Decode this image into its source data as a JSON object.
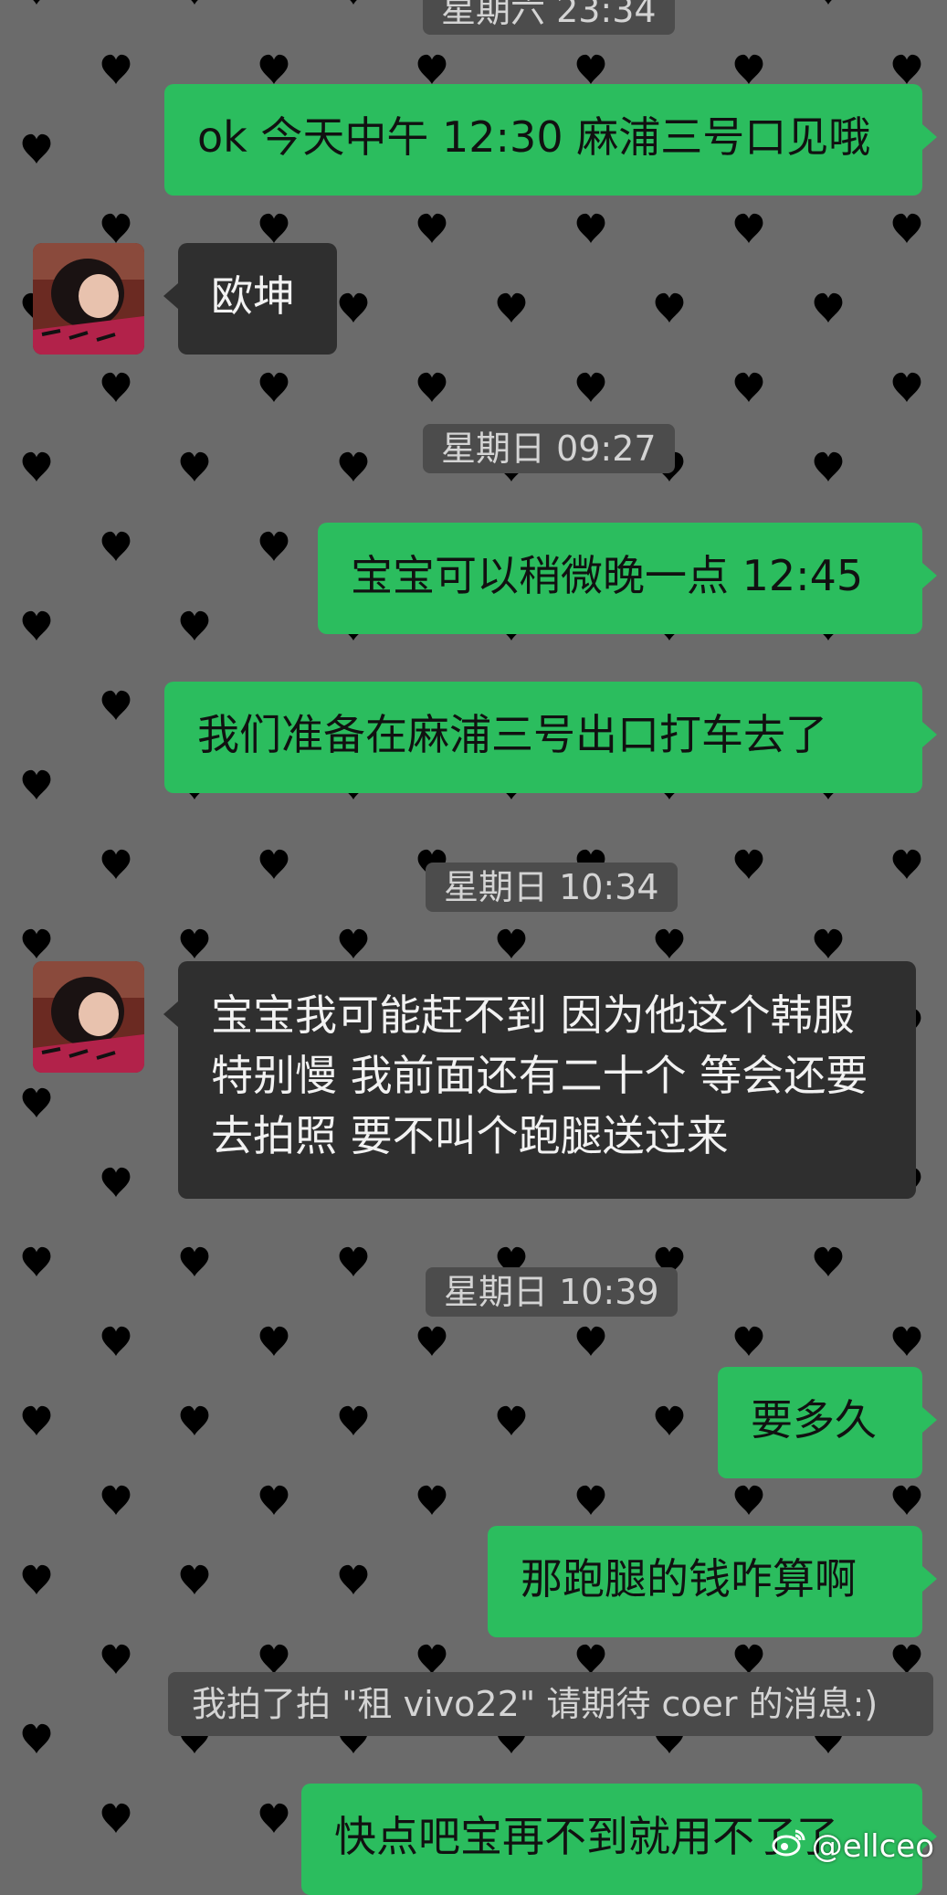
{
  "timestamps": [
    "星期六 23:34",
    "星期日 09:27",
    "星期日 10:34",
    "星期日 10:39"
  ],
  "messages": {
    "m1": "ok 今天中午 12:30 麻浦三号口见哦",
    "m2": "欧坤",
    "m3": "宝宝可以稍微晚一点 12:45",
    "m4": "我们准备在麻浦三号出口打车去了",
    "m5": "宝宝我可能赶不到 因为他这个韩服特别慢 我前面还有二十个 等会还要去拍照 要不叫个跑腿送过来",
    "m6": "要多久",
    "m7": "那跑腿的钱咋算啊",
    "m8": "快点吧宝再不到就用不了了"
  },
  "system": {
    "pat": "我拍了拍 \"租 vivo22\" 请期待 coer 的消息:)"
  },
  "watermark": {
    "handle": "@ellceo",
    "icon": "weibo-icon"
  },
  "colors": {
    "background": "#6b6b6b",
    "outgoing": "#2bbd5e",
    "incoming": "#2f2f2f",
    "timestamp": "#4c4c4c"
  }
}
